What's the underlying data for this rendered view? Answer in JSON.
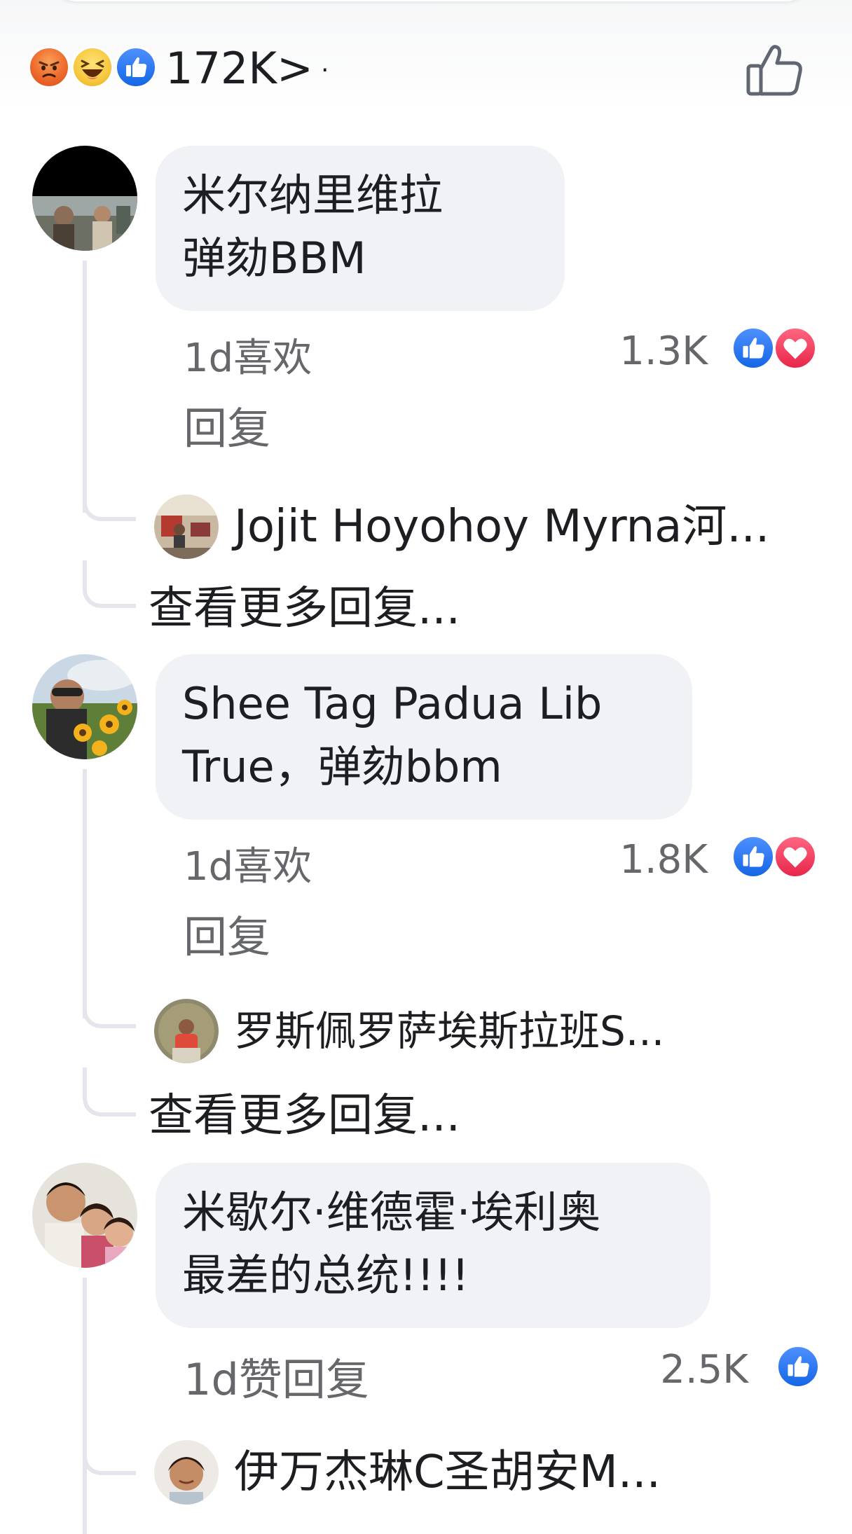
{
  "summary": {
    "reactions": [
      "angry-emoji",
      "haha-emoji",
      "like-emoji"
    ],
    "count": "172K>",
    "dot": "·"
  },
  "comments": [
    {
      "author": "米尔纳里维拉",
      "text": "弹劾BBM",
      "time_actions": "1d喜欢",
      "reply": "回复",
      "count": "1.3K",
      "reactions": [
        "like",
        "love"
      ],
      "reply_preview": "Jojit Hoyohoy Myrna河...",
      "more_replies": "查看更多回复..."
    },
    {
      "author": "Shee Tag Padua Lib",
      "text": "True，弹劾bbm",
      "time_actions": "1d喜欢",
      "reply": "回复",
      "count": "1.8K",
      "reactions": [
        "like",
        "love"
      ],
      "reply_preview": "罗斯佩罗萨埃斯拉班S...",
      "more_replies": "查看更多回复..."
    },
    {
      "author": "米歇尔·维德霍·埃利奥",
      "text": "最差的总统!!!!",
      "time_actions": "1d赞回复",
      "count": "2.5K",
      "reactions": [
        "like"
      ],
      "reply_preview": "伊万杰琳C圣胡安M..."
    }
  ],
  "colors": {
    "like_blue": "#1877f2",
    "love_red": "#f02849",
    "bubble_bg": "#f0f2f5",
    "meta_gray": "#65676b"
  }
}
